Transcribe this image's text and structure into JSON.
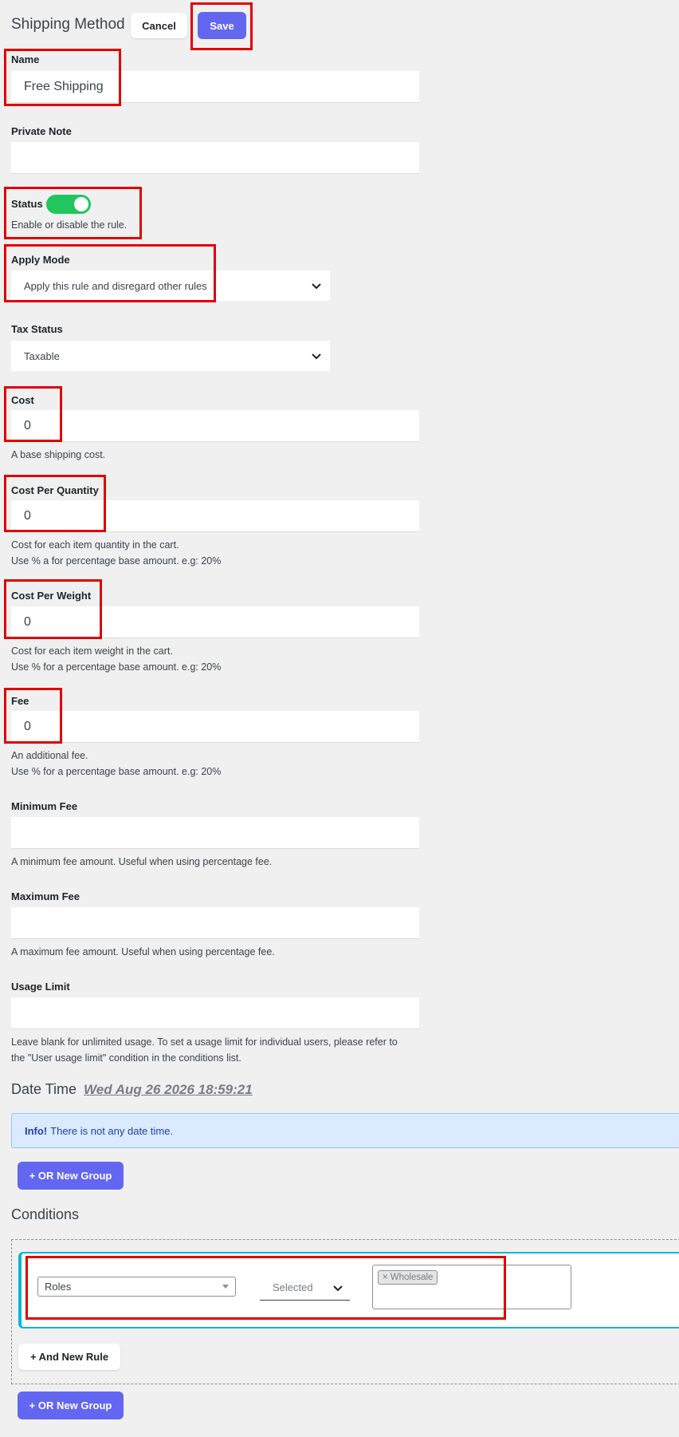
{
  "header": {
    "title": "Shipping Method",
    "cancel_label": "Cancel",
    "save_label": "Save"
  },
  "name": {
    "label": "Name",
    "value": "Free Shipping"
  },
  "private_note": {
    "label": "Private Note",
    "value": ""
  },
  "status": {
    "label": "Status",
    "enabled": true,
    "help": "Enable or disable the rule."
  },
  "apply_mode": {
    "label": "Apply Mode",
    "value": "Apply this rule and disregard other rules"
  },
  "tax_status": {
    "label": "Tax Status",
    "value": "Taxable"
  },
  "cost": {
    "label": "Cost",
    "value": "0",
    "help": "A base shipping cost."
  },
  "cost_per_quantity": {
    "label": "Cost Per Quantity",
    "value": "0",
    "help1": "Cost for each item quantity in the cart.",
    "help2": "Use % a for percentage base amount. e.g: 20%"
  },
  "cost_per_weight": {
    "label": "Cost Per Weight",
    "value": "0",
    "help1": "Cost for each item weight in the cart.",
    "help2": "Use % for a percentage base amount. e.g: 20%"
  },
  "fee": {
    "label": "Fee",
    "value": "0",
    "help1": "An additional fee.",
    "help2": "Use % for a percentage base amount. e.g: 20%"
  },
  "minimum_fee": {
    "label": "Minimum Fee",
    "value": "",
    "help": "A minimum fee amount. Useful when using percentage fee."
  },
  "maximum_fee": {
    "label": "Maximum Fee",
    "value": "",
    "help": "A maximum fee amount. Useful when using percentage fee."
  },
  "usage_limit": {
    "label": "Usage Limit",
    "value": "",
    "help1": "Leave blank for unlimited usage. To set a usage limit for individual users, please refer to",
    "help2": "the \"User usage limit\" condition in the conditions list."
  },
  "date_time": {
    "label": "Date Time",
    "value": "Wed Aug 26 2026 18:59:21"
  },
  "info": {
    "strong": "Info!",
    "text": "There is not any date time."
  },
  "or_new_group_label": "+ OR New Group",
  "conditions": {
    "title": "Conditions",
    "rule": {
      "type": "Roles",
      "operator": "Selected",
      "tag": "Wholesale",
      "tag_remove": "×"
    },
    "and_new_rule_label": "+ And New Rule"
  },
  "colors": {
    "accent": "#6366f1",
    "toggle_on": "#22c55e",
    "highlight": "#e00000",
    "info_bg": "#dbeafe",
    "condition_border": "#06b6d4"
  }
}
